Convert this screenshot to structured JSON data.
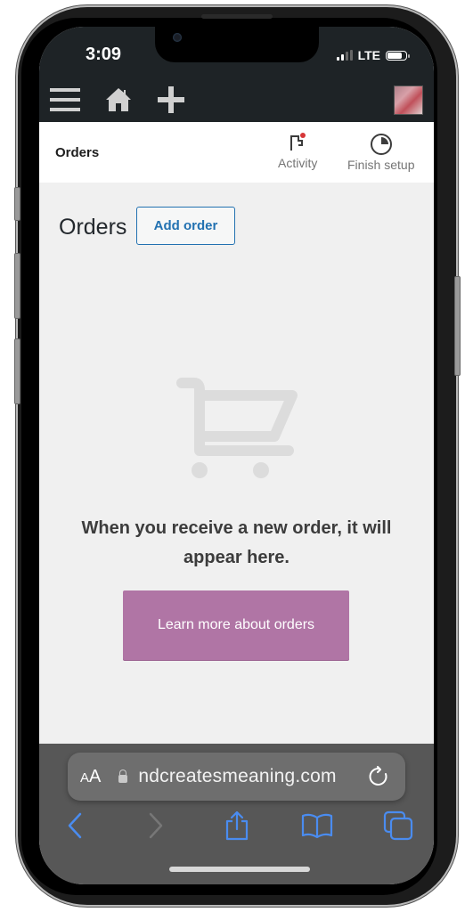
{
  "status_bar": {
    "time": "3:09",
    "network": "LTE",
    "signal_bars_active": 2,
    "signal_bars_total": 4,
    "battery_level": 0.8
  },
  "top_nav": {
    "icons": [
      "menu-icon",
      "home-icon",
      "plus-icon"
    ],
    "avatar": "user-avatar"
  },
  "subheader": {
    "title": "Orders",
    "activity_label": "Activity",
    "activity_has_notification": true,
    "finish_setup_label": "Finish setup"
  },
  "main": {
    "page_title": "Orders",
    "add_order_label": "Add order",
    "empty_icon": "shopping-cart-icon",
    "empty_message": "When you receive a new order, it will appear here.",
    "learn_more_label": "Learn more about orders"
  },
  "browser": {
    "text_size_label_small": "A",
    "text_size_label_large": "A",
    "url": "ndcreatesmeaning.com",
    "toolbar": [
      "back-icon",
      "forward-icon",
      "share-icon",
      "bookmarks-icon",
      "tabs-icon"
    ]
  },
  "colors": {
    "topbar": "#1e2326",
    "primary_blue": "#2271b1",
    "learn_button": "#b075a5",
    "safari_blue": "#4a8cf0",
    "notification_dot": "#d63638"
  }
}
